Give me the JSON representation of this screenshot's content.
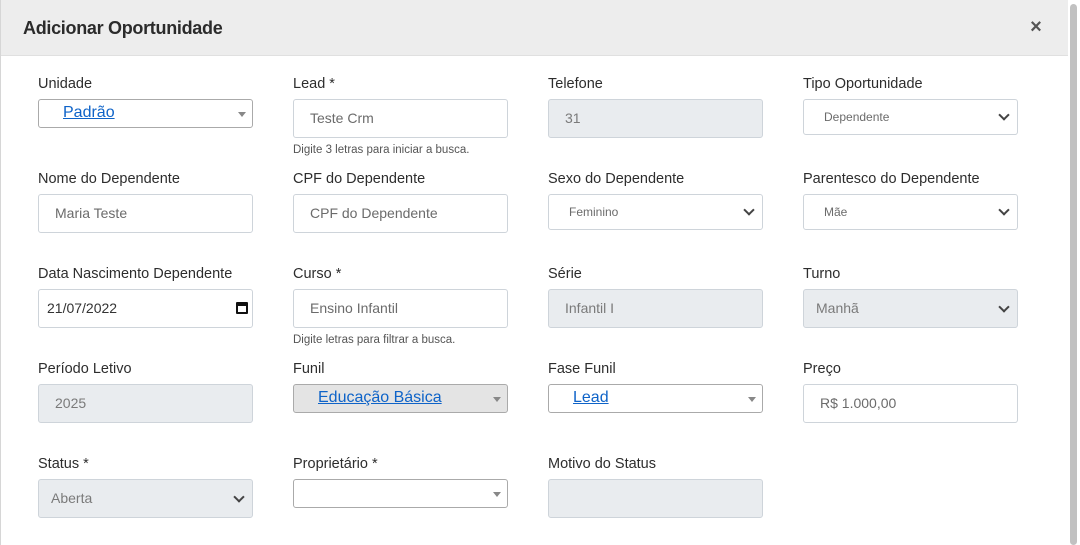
{
  "modal": {
    "title": "Adicionar Oportunidade",
    "close_symbol": "×"
  },
  "fields": {
    "unidade": {
      "label": "Unidade",
      "value": "Padrão"
    },
    "lead": {
      "label": "Lead *",
      "value": "Teste Crm",
      "hint": "Digite 3 letras para iniciar a busca."
    },
    "telefone": {
      "label": "Telefone",
      "value": "31"
    },
    "tipo_oportunidade": {
      "label": "Tipo Oportunidade",
      "value": "Dependente"
    },
    "nome_dependente": {
      "label": "Nome do Dependente",
      "value": "Maria Teste"
    },
    "cpf_dependente": {
      "label": "CPF do Dependente",
      "placeholder": "CPF do Dependente"
    },
    "sexo_dependente": {
      "label": "Sexo do Dependente",
      "value": "Feminino"
    },
    "parentesco_dependente": {
      "label": "Parentesco do Dependente",
      "value": "Mãe"
    },
    "data_nascimento": {
      "label": "Data Nascimento Dependente",
      "value": "21/07/2022"
    },
    "curso": {
      "label": "Curso *",
      "value": "Ensino Infantil",
      "hint": "Digite letras para filtrar a busca."
    },
    "serie": {
      "label": "Série",
      "value": "Infantil I"
    },
    "turno": {
      "label": "Turno",
      "value": "Manhã"
    },
    "periodo_letivo": {
      "label": "Período Letivo",
      "value": "2025"
    },
    "funil": {
      "label": "Funil",
      "value": "Educação Básica"
    },
    "fase_funil": {
      "label": "Fase Funil",
      "value": "Lead"
    },
    "preco": {
      "label": "Preço",
      "value": "R$ 1.000,00"
    },
    "status": {
      "label": "Status *",
      "value": "Aberta"
    },
    "proprietario": {
      "label": "Proprietário *",
      "value": ""
    },
    "motivo_status": {
      "label": "Motivo do Status",
      "value": ""
    }
  },
  "colors": {
    "header_bg": "#ededed",
    "link": "#0e63c8",
    "disabled_bg": "#e9ecef"
  }
}
